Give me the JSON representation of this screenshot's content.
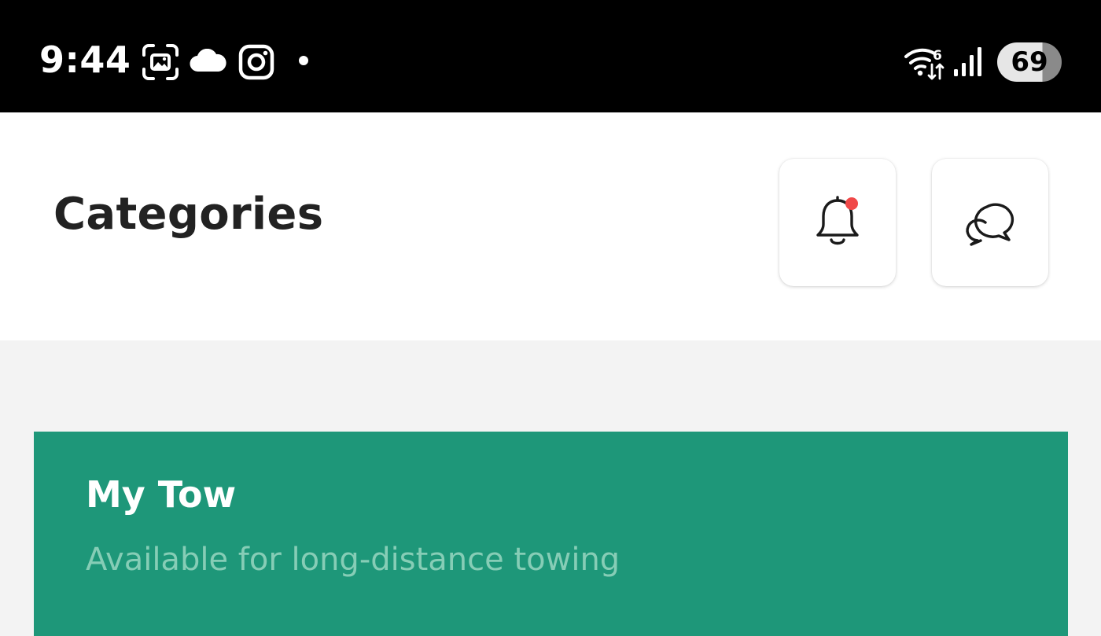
{
  "status_bar": {
    "time": "9:44",
    "battery": "69",
    "icons": [
      "screenshot-icon",
      "cloud-icon",
      "instagram-icon",
      "notification-dot-icon",
      "wifi-6-icon",
      "cellular-signal-icon",
      "battery-icon"
    ]
  },
  "header": {
    "title": "Categories",
    "notifications_icon": "bell-icon",
    "messages_icon": "chat-bubbles-icon",
    "has_unread_notification": true
  },
  "categories": [
    {
      "title": "My Tow",
      "subtitle": "Available for long-distance towing"
    }
  ],
  "colors": {
    "status_bar_bg": "#000000",
    "page_bg": "#f3f3f3",
    "card_bg": "#1e9779",
    "card_subtitle": "#86cdb6",
    "badge": "#f04848"
  }
}
